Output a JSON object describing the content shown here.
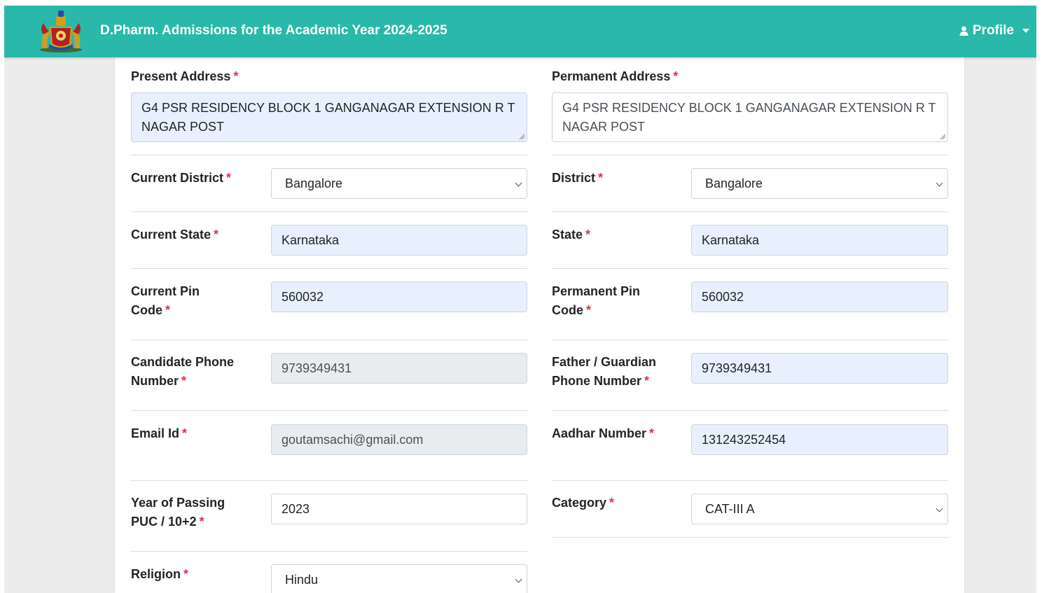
{
  "header": {
    "title": "D.Pharm. Admissions for the Academic Year 2024-2025",
    "profile_label": "Profile"
  },
  "colors": {
    "header_bg": "#2ab8aa",
    "required": "#dc3545",
    "autofill_bg": "#e8f0fe",
    "disabled_bg": "#e9ecef"
  },
  "icons": {
    "logo": "karnataka-emblem-logo",
    "profile": "user-icon",
    "dropdown": "caret-down-icon"
  },
  "form": {
    "present_address": {
      "label": "Present Address",
      "value": "G4 PSR RESIDENCY BLOCK 1 GANGANAGAR EXTENSION R T NAGAR POST"
    },
    "permanent_address": {
      "label": "Permanent Address",
      "value": "G4 PSR RESIDENCY BLOCK 1 GANGANAGAR EXTENSION R T NAGAR POST"
    },
    "current_district": {
      "label": "Current District",
      "value": "Bangalore"
    },
    "district": {
      "label": "District",
      "value": "Bangalore"
    },
    "current_state": {
      "label": "Current State",
      "value": "Karnataka"
    },
    "state": {
      "label": "State",
      "value": "Karnataka"
    },
    "current_pin": {
      "label_line1": "Current Pin",
      "label_line2": "Code",
      "value": "560032"
    },
    "permanent_pin": {
      "label_line1": "Permanent Pin",
      "label_line2": "Code",
      "value": "560032"
    },
    "candidate_phone": {
      "label_line1": "Candidate Phone",
      "label_line2": "Number",
      "value": "9739349431"
    },
    "guardian_phone": {
      "label_line1": "Father / Guardian",
      "label_line2": "Phone Number",
      "value": "9739349431"
    },
    "email": {
      "label": "Email Id",
      "value": "goutamsachi@gmail.com"
    },
    "aadhar": {
      "label": "Aadhar Number",
      "value": "131243252454"
    },
    "year_passing": {
      "label_line1": "Year of Passing",
      "label_line2": "PUC / 10+2",
      "value": "2023"
    },
    "category": {
      "label": "Category",
      "value": "CAT-III A"
    },
    "religion": {
      "label": "Religion",
      "value": "Hindu"
    },
    "required_marker": "*"
  }
}
